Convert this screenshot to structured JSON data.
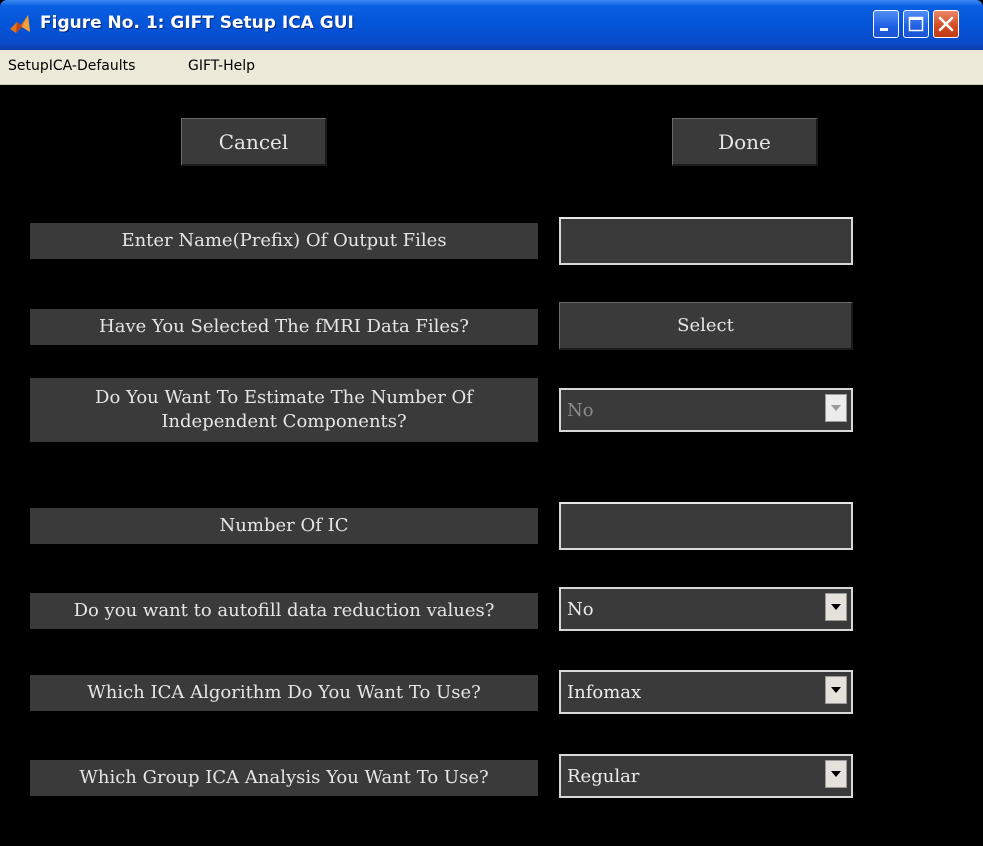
{
  "window": {
    "title": "Figure No. 1: GIFT Setup ICA GUI",
    "app_icon": "matlab-icon",
    "controls": [
      "minimize-icon",
      "maximize-icon",
      "close-icon"
    ]
  },
  "menubar": {
    "items": [
      {
        "label": "SetupICA-Defaults"
      },
      {
        "label": "GIFT-Help"
      }
    ]
  },
  "buttons": {
    "cancel_label": "Cancel",
    "done_label": "Done"
  },
  "form": {
    "output_prefix": {
      "label": "Enter Name(Prefix) Of Output Files",
      "value": ""
    },
    "data_files": {
      "label": "Have You Selected The fMRI Data Files?",
      "button_label": "Select"
    },
    "estimate_components": {
      "label_line1": "Do You Want To Estimate The Number Of",
      "label_line2": "Independent Components?",
      "value": "No",
      "enabled": false
    },
    "number_of_ic": {
      "label": "Number Of IC",
      "value": ""
    },
    "autofill": {
      "label": "Do you want to autofill data reduction values?",
      "value": "No"
    },
    "algorithm": {
      "label": "Which ICA Algorithm Do You Want To Use?",
      "value": "Infomax"
    },
    "group_analysis": {
      "label": "Which Group ICA Analysis You Want To Use?",
      "value": "Regular"
    }
  },
  "colors": {
    "figure_background": "#000000",
    "control_background": "#3a3a3a",
    "control_text": "#e6e6e6",
    "titlebar_blue": "#0354d8",
    "menubar_background": "#ece9d8"
  }
}
